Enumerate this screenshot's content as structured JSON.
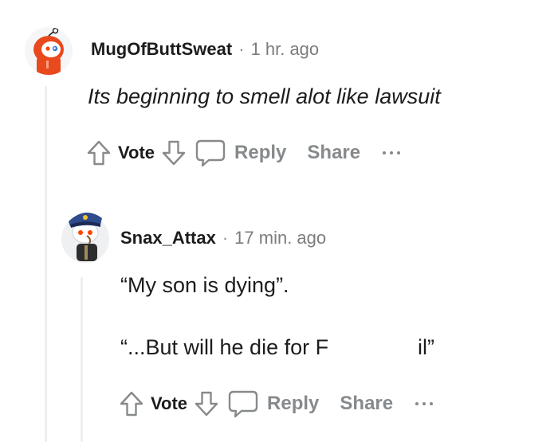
{
  "comments": [
    {
      "username": "MugOfButtSweat",
      "separator": "·",
      "time": "1 hr. ago",
      "lines": [
        "Its beginning to smell alot like lawsuit"
      ],
      "actions": {
        "vote_label": "Vote",
        "reply_label": "Reply",
        "share_label": "Share"
      },
      "avatar_icon": "snoo-orange-hoodie-avatar-icon"
    },
    {
      "username": "Snax_Attax",
      "separator": "·",
      "time": "17 min. ago",
      "lines": [
        "“My son is dying”.",
        "“...But will he die for F",
        "il”"
      ],
      "actions": {
        "vote_label": "Vote",
        "reply_label": "Reply",
        "share_label": "Share"
      },
      "avatar_icon": "snoo-captain-hat-avatar-icon"
    }
  ],
  "colors": {
    "muted": "#878a8c",
    "text": "#1c1c1c",
    "thread_line": "#edeff1"
  }
}
